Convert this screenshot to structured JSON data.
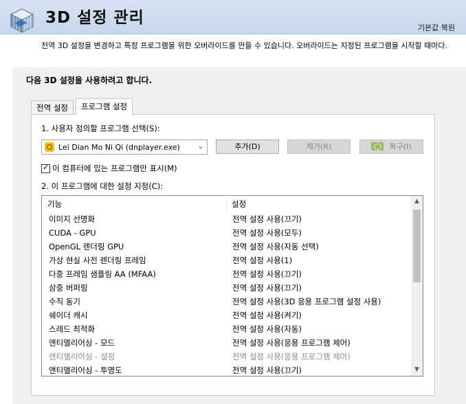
{
  "header": {
    "title": "3D 설정 관리",
    "restore_label": "기본값 복원"
  },
  "description": "전역 3D 설정을 변경하고 특정 프로그램을 위한 오버라이드를 만들 수 있습니다. 오버라이드는 지정된 프로그램을 시작할 때마다.",
  "panel": {
    "heading": "다음 3D 설정을 사용하려고 합니다.",
    "tabs": [
      {
        "label": "전역 설정",
        "active": false
      },
      {
        "label": "프로그램 설정",
        "active": true
      }
    ],
    "step1_label": "1. 사용자 정의할 프로그램 선택(S):",
    "selected_program": "Lei Dian Mo Ni Qi (dnplayer.exe)",
    "buttons": {
      "add": "추가(D)",
      "remove": "제거(R)",
      "restore": "복구(I)"
    },
    "checkbox_label": "이 컴퓨터에 있는 프로그램만 표시(M)",
    "checkbox_checked": true,
    "step2_label": "2. 이 프로그램에 대한 설정 지정(C):",
    "columns": [
      "기능",
      "설정"
    ],
    "rows": [
      {
        "feature": "이미지 선명화",
        "setting": "전역 설정 사용(끄기)",
        "disabled": false
      },
      {
        "feature": "CUDA - GPU",
        "setting": "전역 설정 사용(모두)",
        "disabled": false
      },
      {
        "feature": "OpenGL 렌더링 GPU",
        "setting": "전역 설정 사용(자동 선택)",
        "disabled": false
      },
      {
        "feature": "가상 현실 사전 렌더링 프레임",
        "setting": "전역 설정 사용(1)",
        "disabled": false
      },
      {
        "feature": "다중 프레임 샘플링 AA (MFAA)",
        "setting": "전역 설정 사용(끄기)",
        "disabled": false
      },
      {
        "feature": "삼중 버퍼링",
        "setting": "전역 설정 사용(끄기)",
        "disabled": false
      },
      {
        "feature": "수직 동기",
        "setting": "전역 설정 사용(3D 응용 프로그램 설정 사용)",
        "disabled": false
      },
      {
        "feature": "쉐이더 캐시",
        "setting": "전역 설정 사용(켜기)",
        "disabled": false
      },
      {
        "feature": "스레드 최적화",
        "setting": "전역 설정 사용(자동)",
        "disabled": false
      },
      {
        "feature": "앤티앨리어싱 - 모드",
        "setting": "전역 설정 사용(응용 프로그램 제어)",
        "disabled": false
      },
      {
        "feature": "앤티앨리어싱 - 설정",
        "setting": "전역 설정 사용(응용 프로그램 제어)",
        "disabled": true
      },
      {
        "feature": "앤티앨리어싱 - 투명도",
        "setting": "전역 설정 사용(끄기)",
        "disabled": false
      }
    ]
  },
  "colors": {
    "header_bg": "#c6d6eb",
    "panel_bg": "#f0f0f0",
    "disabled_text": "#8a8a8a"
  },
  "icons": [
    "3d-cube-logo-icon",
    "program-icon",
    "chevron-down-icon",
    "nvidia-icon",
    "checkbox-check-icon",
    "scroll-up-icon",
    "scroll-down-icon"
  ]
}
